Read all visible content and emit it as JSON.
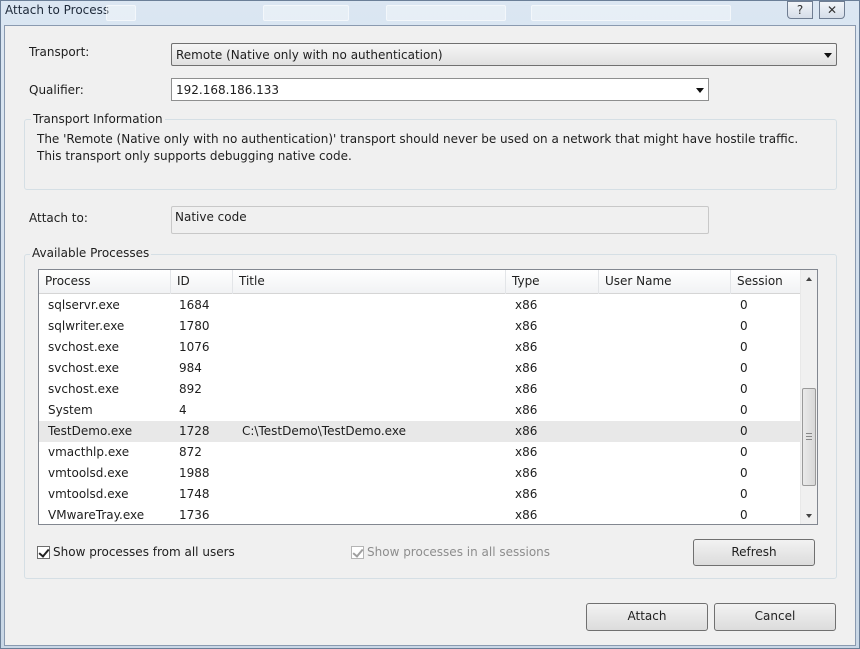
{
  "window": {
    "title": "Attach to Process",
    "help_glyph": "?",
    "close_glyph": "✕"
  },
  "transport": {
    "label": "Transport:",
    "value": "Remote (Native only with no authentication)"
  },
  "qualifier": {
    "label": "Qualifier:",
    "value": "192.168.186.133"
  },
  "transport_info": {
    "title": "Transport Information",
    "text": "The 'Remote (Native only with no authentication)' transport should never be used on a network that might have hostile traffic. This transport only supports debugging native code."
  },
  "attach_to": {
    "label": "Attach to:",
    "value": "Native code"
  },
  "processes": {
    "title": "Available Processes",
    "columns": [
      "Process",
      "ID",
      "Title",
      "Type",
      "User Name",
      "Session"
    ],
    "rows": [
      {
        "process": "sqlservr.exe",
        "id": "1684",
        "title": "",
        "type": "x86",
        "user": "",
        "session": "0"
      },
      {
        "process": "sqlwriter.exe",
        "id": "1780",
        "title": "",
        "type": "x86",
        "user": "",
        "session": "0"
      },
      {
        "process": "svchost.exe",
        "id": "1076",
        "title": "",
        "type": "x86",
        "user": "",
        "session": "0"
      },
      {
        "process": "svchost.exe",
        "id": "984",
        "title": "",
        "type": "x86",
        "user": "",
        "session": "0"
      },
      {
        "process": "svchost.exe",
        "id": "892",
        "title": "",
        "type": "x86",
        "user": "",
        "session": "0"
      },
      {
        "process": "System",
        "id": "4",
        "title": "",
        "type": "x86",
        "user": "",
        "session": "0"
      },
      {
        "process": "TestDemo.exe",
        "id": "1728",
        "title": "C:\\TestDemo\\TestDemo.exe",
        "type": "x86",
        "user": "",
        "session": "0",
        "selected": true
      },
      {
        "process": "vmacthlp.exe",
        "id": "872",
        "title": "",
        "type": "x86",
        "user": "",
        "session": "0"
      },
      {
        "process": "vmtoolsd.exe",
        "id": "1988",
        "title": "",
        "type": "x86",
        "user": "",
        "session": "0"
      },
      {
        "process": "vmtoolsd.exe",
        "id": "1748",
        "title": "",
        "type": "x86",
        "user": "",
        "session": "0"
      },
      {
        "process": "VMwareTray.exe",
        "id": "1736",
        "title": "",
        "type": "x86",
        "user": "",
        "session": "0"
      }
    ],
    "show_all_users": {
      "label": "Show processes from all users",
      "checked": true
    },
    "show_all_sessions": {
      "label": "Show processes in all sessions",
      "checked": true,
      "disabled": true
    },
    "refresh_label": "Refresh"
  },
  "footer": {
    "attach_label": "Attach",
    "cancel_label": "Cancel"
  }
}
